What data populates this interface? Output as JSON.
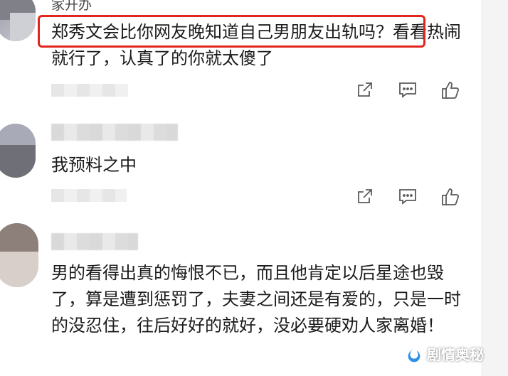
{
  "comments": [
    {
      "username": "家开办",
      "text": "郑秀文会比你网友晚知道自己男朋友出轨吗？看看热闹就行了，认真了的你就太傻了"
    },
    {
      "text": "我预料之中"
    },
    {
      "text": "男的看得出真的悔恨不已，而且他肯定以后星途也毁了，算是遭到惩罚了，夫妻之间还是有爱的，只是一时的没忍住，往后好好的就好，没必要硬劝人家离婚！"
    }
  ],
  "highlight_color": "#e0261f",
  "icons": [
    "share-icon",
    "comment-icon",
    "like-icon"
  ],
  "watermark": {
    "text": "剧情奥秘",
    "logo": "fire-logo-icon"
  }
}
